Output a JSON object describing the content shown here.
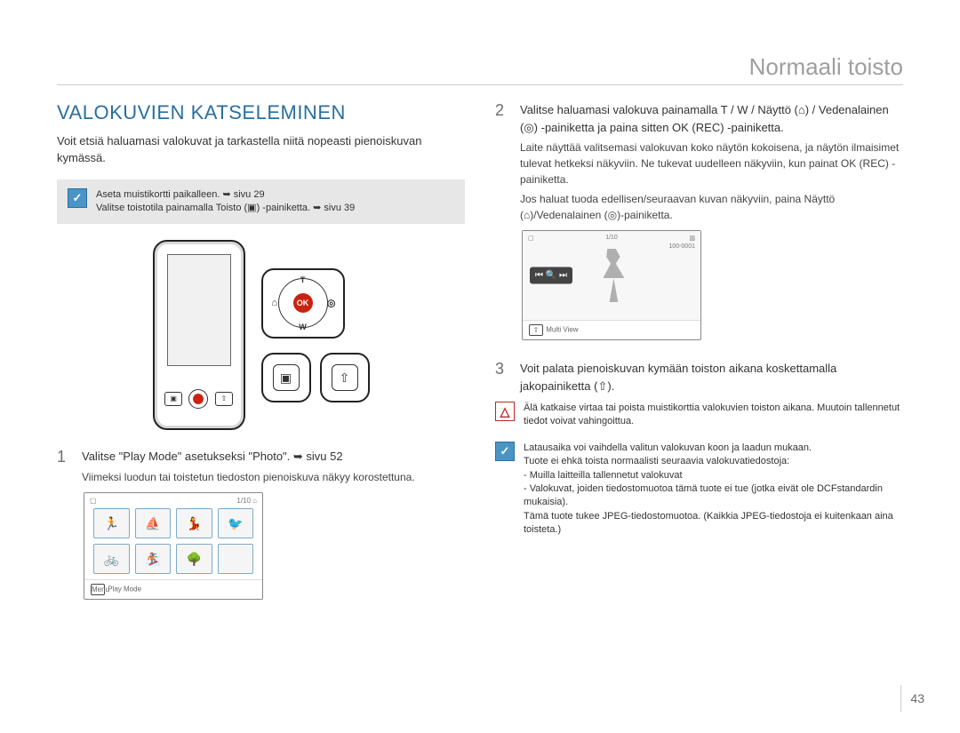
{
  "header": {
    "title": "Normaali toisto"
  },
  "page_number": "43",
  "left": {
    "section_title": "VALOKUVIEN KATSELEMINEN",
    "intro": "Voit etsiä haluamasi valokuvat ja tarkastella niitä nopeasti pienoiskuvan kymässä.",
    "note_line1": "Aseta muistikortti paikalleen. ➥ sivu 29",
    "note_line2": "Valitse toistotila painamalla Toisto (▣) -painiketta. ➥ sivu 39",
    "dpad": {
      "t": "T",
      "w": "W",
      "ok": "OK",
      "left_glyph": "⌂",
      "right_glyph": "◎"
    },
    "panel_play": "▣",
    "panel_share": "⇧",
    "step1_num": "1",
    "step1_text": "Valitse \"Play Mode\" asetukseksi \"Photo\". ➥ sivu 52",
    "step1_sub": "Viimeksi luodun tai toistetun tiedoston pienoiskuva näkyy korostettuna.",
    "thumb_top_left_glyph": "▢",
    "thumb_top_right": "1/10 ⌂",
    "thumb_menu": "Menu",
    "thumb_bot": "Play Mode"
  },
  "right": {
    "step2_num": "2",
    "step2_line1": "Valitse haluamasi valokuva painamalla T / W / Näyttö (⌂) / Vedenalainen (◎) -painiketta ja paina sitten OK (REC) -painiketta.",
    "step2_bul1": "Laite näyttää valitsemasi valokuvan koko näytön kokoisena, ja näytön ilmaisimet tulevat hetkeksi näkyviin. Ne tukevat uudelleen näkyviin, kun painat OK (REC) -painiketta.",
    "step2_bul2": "Jos haluat tuoda edellisen/seuraavan kuvan näkyviin, paina Näyttö (⌂)/Vedenalainen (◎)-painiketta.",
    "photo": {
      "tl_glyph": "▢",
      "tc": "1/10",
      "tr_glyph": "▥",
      "tr2": "100-0001",
      "ovl": "⏮ 🔍 ⏭",
      "bot_icon": "⇧",
      "bot": "Multi View"
    },
    "step3_num": "3",
    "step3_text": "Voit palata pienoiskuvan kymään toiston aikana koskettamalla jakopainiketta (⇧).",
    "warn_glyph": "△",
    "warn_text": "Älä katkaise virtaa tai poista muistikorttia valokuvien toiston aikana. Muutoin tallennetut tiedot voivat vahingoittua.",
    "info_glyph": "✓",
    "info_l1": "Latausaika voi vaihdella valitun valokuvan koon ja laadun mukaan.",
    "info_l2": "Tuote ei ehkä toista normaalisti seuraavia valokuvatiedostoja:",
    "info_b1": "- Muilla laitteilla tallennetut valokuvat",
    "info_b2": "- Valokuvat, joiden tiedostomuotoa tämä tuote ei tue (jotka eivät ole DCFstandardin mukaisia).",
    "info_l3": "Tämä tuote tukee JPEG-tiedostomuotoa. (Kaikkia JPEG-tiedostoja ei kuitenkaan aina toisteta.)"
  }
}
